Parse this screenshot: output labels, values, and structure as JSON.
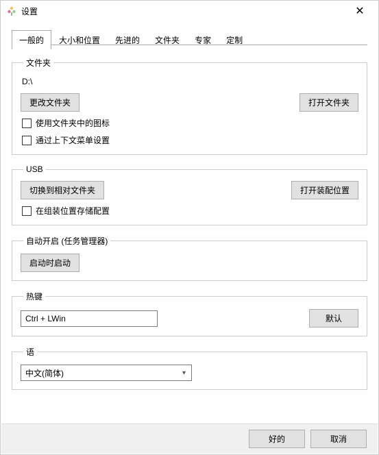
{
  "window": {
    "title": "设置"
  },
  "tabs": {
    "general": "一般的",
    "size_pos": "大小和位置",
    "advanced": "先进的",
    "folders": "文件夹",
    "expert": "专家",
    "custom": "定制"
  },
  "group_folder": {
    "legend": "文件夹",
    "path": "D:\\",
    "btn_change": "更改文件夹",
    "btn_open": "打开文件夹",
    "chk_use_folder_icons": "使用文件夹中的图标",
    "chk_via_context_menu": "通过上下文菜单设置"
  },
  "group_usb": {
    "legend": "USB",
    "btn_switch_relative": "切换到相对文件夹",
    "btn_open_install": "打开装配位置",
    "chk_store_config": "在组装位置存储配置"
  },
  "group_autostart": {
    "legend": "自动开启 (任务管理器)",
    "btn_start_on_boot": "启动时启动"
  },
  "group_hotkey": {
    "legend": "热键",
    "value": "Ctrl + LWin",
    "btn_default": "默认"
  },
  "group_lang": {
    "legend": "语",
    "selected": "中文(简体)"
  },
  "footer": {
    "ok": "好的",
    "cancel": "取消"
  }
}
